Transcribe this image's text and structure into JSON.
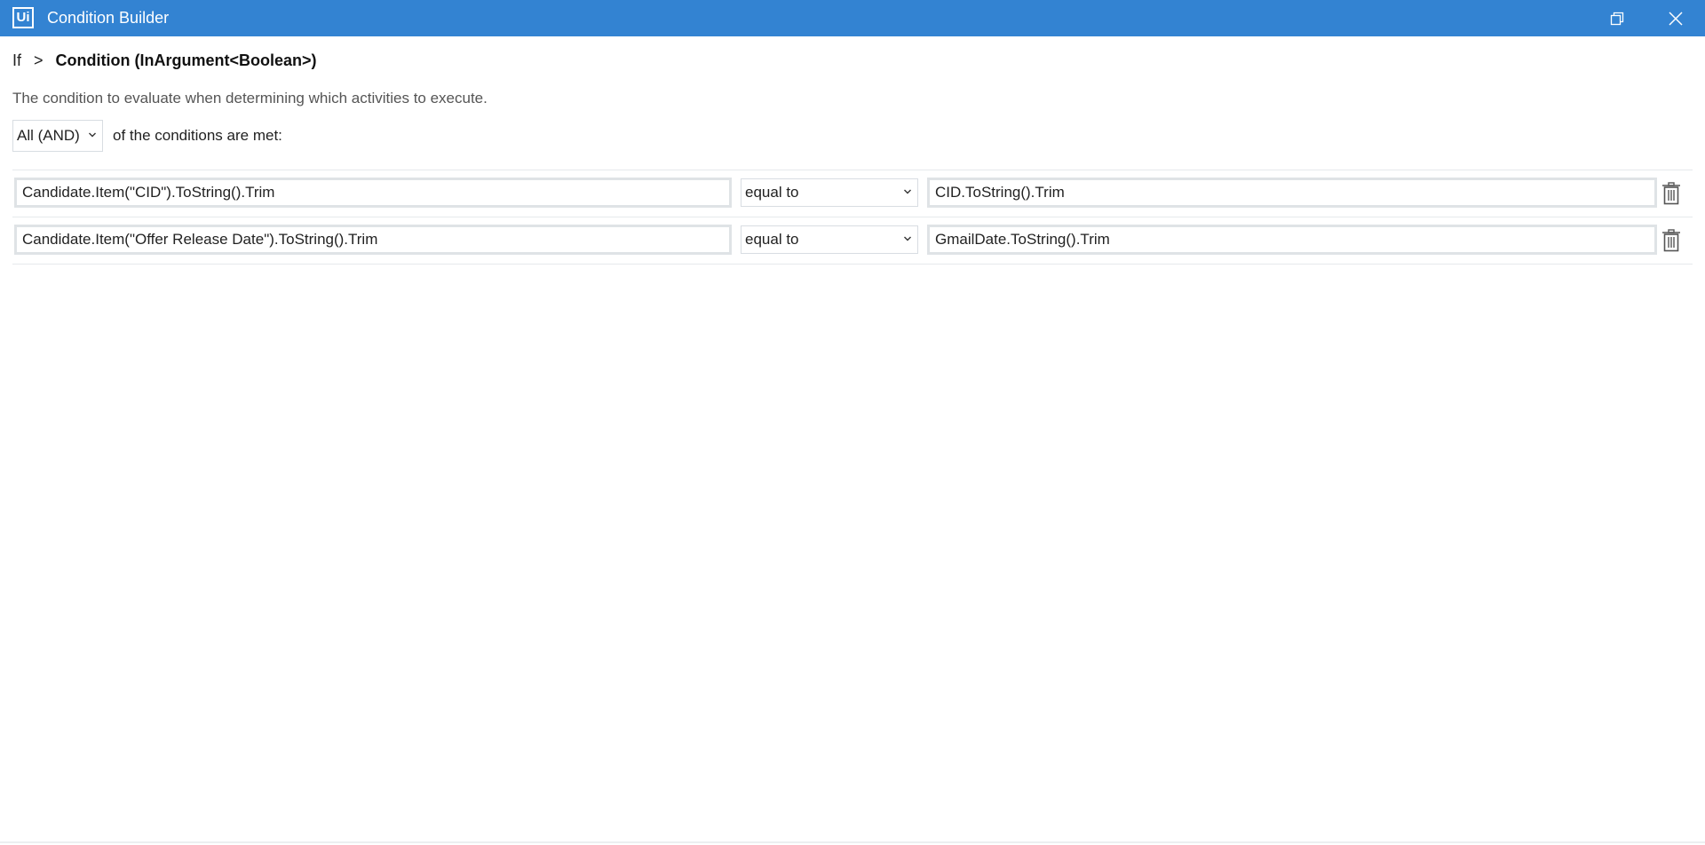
{
  "window": {
    "logo_text": "Ui",
    "title": "Condition Builder",
    "accent_color": "#3383d2"
  },
  "breadcrumb": {
    "root": "If",
    "separator": ">",
    "current": "Condition (InArgument<Boolean>)"
  },
  "description": "The condition to evaluate when determining which activities to execute.",
  "logic": {
    "selected": "All (AND)",
    "suffix": "of the conditions are met:"
  },
  "conditions": [
    {
      "left": "Candidate.Item(\"CID\").ToString().Trim",
      "operator": "equal to",
      "right": "CID.ToString().Trim"
    },
    {
      "left": "Candidate.Item(\"Offer Release Date\").ToString().Trim",
      "operator": "equal to",
      "right": "GmailDate.ToString().Trim"
    }
  ],
  "icons": {
    "restore": "restore-icon",
    "close": "close-icon",
    "delete": "trash-icon",
    "dropdown": "chevron-down-icon"
  }
}
